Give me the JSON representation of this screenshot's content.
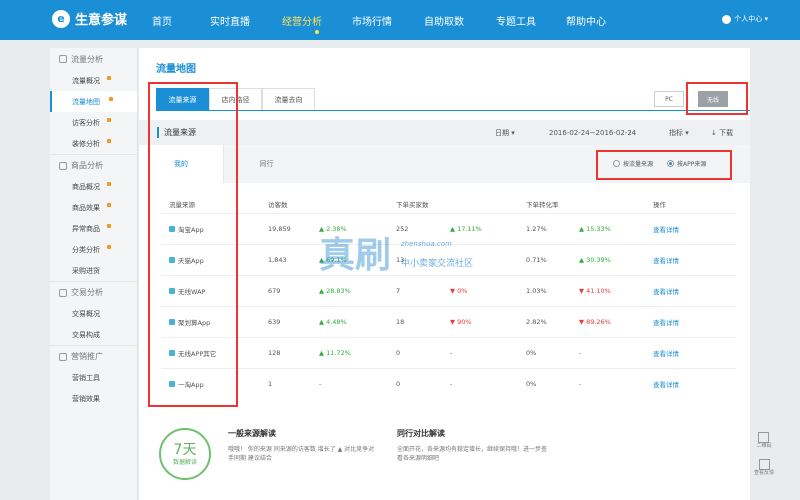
{
  "app": {
    "logo_text": "生意参谋",
    "logo_glyph": "e"
  },
  "nav": {
    "items": [
      {
        "label": "首页"
      },
      {
        "label": "实时直播"
      },
      {
        "label": "经营分析",
        "active": true
      },
      {
        "label": "市场行情"
      },
      {
        "label": "自助取数"
      },
      {
        "label": "专题工具"
      },
      {
        "label": "帮助中心"
      }
    ],
    "user_label": "个人中心 ▾"
  },
  "sidebar": {
    "groups": [
      {
        "title": "流量分析",
        "icon": "eye-icon",
        "items": [
          {
            "label": "流量概况",
            "badge": true
          },
          {
            "label": "流量地图",
            "active": true,
            "badge": true
          },
          {
            "label": "访客分析",
            "badge": true
          },
          {
            "label": "装修分析",
            "badge": true
          }
        ]
      },
      {
        "title": "商品分析",
        "icon": "box-icon",
        "items": [
          {
            "label": "商品概况",
            "badge": true
          },
          {
            "label": "商品效果",
            "badge": true
          },
          {
            "label": "异常商品",
            "badge": true
          },
          {
            "label": "分类分析",
            "badge": true
          },
          {
            "label": "采购进货"
          }
        ]
      },
      {
        "title": "交易分析",
        "icon": "cart-icon",
        "items": [
          {
            "label": "交易概况"
          },
          {
            "label": "交易构成"
          }
        ]
      },
      {
        "title": "营销推广",
        "icon": "megaphone-icon",
        "items": [
          {
            "label": "营销工具"
          },
          {
            "label": "营销效果"
          }
        ]
      }
    ]
  },
  "page": {
    "title": "流量地图",
    "tabs": [
      "流量来源",
      "店内路径",
      "流量去向"
    ],
    "device": [
      "PC",
      "无线"
    ],
    "filter": {
      "title": "流量来源",
      "date_label": "日期 ▾",
      "date_range": "2016-02-24~2016-02-24",
      "metric": "指标 ▾",
      "download": "↓ 下载"
    },
    "subtabs": [
      "我的",
      "同行"
    ],
    "radios": [
      "按流量来源",
      "按APP来源"
    ]
  },
  "table": {
    "headers": [
      "流量来源",
      "访客数",
      "",
      "下单买家数",
      "",
      "下单转化率",
      "",
      "操作"
    ],
    "rows": [
      {
        "source": "淘宝App",
        "visitors": "19,859",
        "v_change": "▲ 2.38%",
        "buyers": "252",
        "b_change": "▲ 17.11%",
        "rate": "1.27%",
        "r_change": "▲ 15.33%",
        "action": "查看详情"
      },
      {
        "source": "天猫App",
        "visitors": "1,843",
        "v_change": "▲ 69.1%",
        "buyers": "13",
        "b_change": "",
        "rate": "0.71%",
        "r_change": "▲ 30.39%",
        "action": "查看详情"
      },
      {
        "source": "无线WAP",
        "visitors": "679",
        "v_change": "▲ 28.83%",
        "buyers": "7",
        "b_change": "▼ 0%",
        "rate": "1.03%",
        "r_change": "▼ 41.10%",
        "action": "查看详情"
      },
      {
        "source": "聚划算App",
        "visitors": "639",
        "v_change": "▲ 4.48%",
        "buyers": "18",
        "b_change": "▼ 90%",
        "rate": "2.82%",
        "r_change": "▼ 89.26%",
        "action": "查看详情"
      },
      {
        "source": "无线APP其它",
        "visitors": "128",
        "v_change": "▲ 11.72%",
        "buyers": "0",
        "b_change": "-",
        "rate": "0%",
        "r_change": "-",
        "action": "查看详情"
      },
      {
        "source": "一淘App",
        "visitors": "1",
        "v_change": "-",
        "buyers": "0",
        "b_change": "-",
        "rate": "0%",
        "r_change": "-",
        "action": "查看详情"
      }
    ]
  },
  "watermark": {
    "main": "真刷",
    "site": "zhenshua.com",
    "sub": "中小卖家交流社区"
  },
  "bottom": {
    "days_num": "7天",
    "days_label": "数据解读",
    "panel_a_title": "一般来源解读",
    "panel_a_text": "哦哦！ 你的来源 同来源的访客数 增长了 ▲ 对比竞争对手同期 建议结合",
    "panel_b_title": "同行对比解读",
    "panel_b_text": "全面开花，各来源均有稳定增长，继续保持哦！进一步查看各来源明细吧"
  },
  "float_tools": [
    "二维码",
    "查看反馈"
  ],
  "colors": {
    "primary": "#1b8fd6",
    "active_nav": "#ffe35a",
    "up": "#2fae3a",
    "down": "#e43c3c",
    "annotation": "#e33333"
  }
}
